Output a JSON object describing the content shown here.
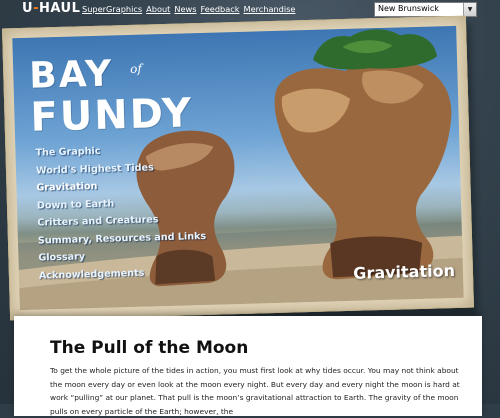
{
  "header": {
    "logo": {
      "text_main": "U",
      "text_dash": "-",
      "text_rest": "HAUL"
    },
    "nav": [
      {
        "label": "SuperGraphics"
      },
      {
        "label": "About"
      },
      {
        "label": "News"
      },
      {
        "label": "Feedback"
      },
      {
        "label": "Merchandise"
      }
    ],
    "region_select": {
      "value": "New Brunswick"
    }
  },
  "postcard": {
    "title_line1": "BAY",
    "title_of": "of",
    "title_line2": "FUNDY",
    "menu": [
      {
        "label": "The Graphic"
      },
      {
        "label": "World's Highest Tides"
      },
      {
        "label": "Gravitation"
      },
      {
        "label": "Down to Earth"
      },
      {
        "label": "Critters and Creatures"
      },
      {
        "label": "Summary, Resources and Links"
      },
      {
        "label": "Glossary"
      },
      {
        "label": "Acknowledgements"
      }
    ],
    "section_label": "Gravitation"
  },
  "article": {
    "heading": "The Pull of the Moon",
    "body": "To get the whole picture of the tides in action, you must first look at why tides occur. You may not think about the moon every day or even look at the moon every night. But every day and every night the moon is hard at work “pulling” at our planet. That pull is the moon’s gravitational attraction to Earth. The gravity of the moon pulls on every particle of the Earth; however, the"
  },
  "colors": {
    "accent": "#f47b20",
    "page_bg": "#2f3d48",
    "postcard_border": "#e6d9bd",
    "sky_top": "#3d76b3"
  }
}
